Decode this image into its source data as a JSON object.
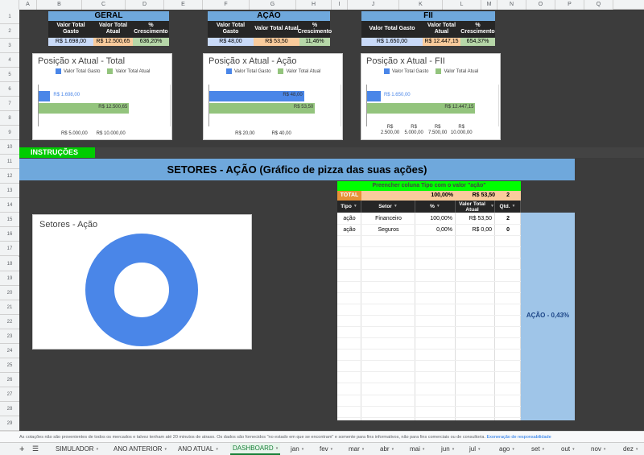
{
  "columns": [
    "A",
    "B",
    "C",
    "D",
    "E",
    "F",
    "G",
    "H",
    "I",
    "J",
    "K",
    "L",
    "M",
    "N",
    "O",
    "P",
    "Q",
    "R"
  ],
  "rows": [
    "1",
    "2",
    "3",
    "4",
    "5",
    "6",
    "7",
    "8",
    "9",
    "10",
    "11",
    "12",
    "13",
    "14",
    "15",
    "16",
    "17",
    "18",
    "19",
    "20",
    "21",
    "22",
    "23",
    "24",
    "25",
    "26",
    "27",
    "28",
    "29"
  ],
  "summary": {
    "geral": {
      "title": "GERAL",
      "h1": "Valor Total Gasto",
      "h2": "Valor Total Atual",
      "h3": "% Crescimento",
      "v1": "R$ 1.698,00",
      "v2": "R$ 12.500,65",
      "v3": "636,20%"
    },
    "acao": {
      "title": "AÇÃO",
      "h1": "Valor Total Gasto",
      "h2": "Valor Total Atual",
      "h3": "% Crescimento",
      "v1": "R$ 48,00",
      "v2": "R$ 53,50",
      "v3": "11,46%"
    },
    "fii": {
      "title": "FII",
      "h1": "Valor Total Gasto",
      "h2": "Valor Total Atual",
      "h3": "% Crescimento",
      "v1": "R$ 1.650,00",
      "v2": "R$ 12.447,15",
      "v3": "654,37%"
    }
  },
  "legend": {
    "gasto": "Valor Total Gasto",
    "atual": "Valor Total Atual"
  },
  "colors": {
    "gasto": "#4a86e8",
    "atual": "#93c47d",
    "header_blue": "#6fa8dc",
    "header_green": "#00ff00",
    "gray_band": "#b7b7b7"
  },
  "chart_data": [
    {
      "type": "bar",
      "title": "Posição x Atual - Total",
      "series": [
        {
          "name": "Valor Total Gasto",
          "values": [
            1698.0
          ]
        },
        {
          "name": "Valor Total Atual",
          "values": [
            12500.65
          ]
        }
      ],
      "labels": [
        "R$ 1.698,00",
        "R$ 12.500,65"
      ],
      "xticks": [
        "R$ 5.000,00",
        "R$ 10.000,00"
      ],
      "xlim": [
        0,
        15000
      ]
    },
    {
      "type": "bar",
      "title": "Posição x Atual - Ação",
      "series": [
        {
          "name": "Valor Total Gasto",
          "values": [
            48.0
          ]
        },
        {
          "name": "Valor Total Atual",
          "values": [
            53.5
          ]
        }
      ],
      "labels": [
        "R$ 48,00",
        "R$ 53,50"
      ],
      "xticks": [
        "R$ 20,00",
        "R$ 40,00"
      ],
      "xlim": [
        0,
        55
      ]
    },
    {
      "type": "bar",
      "title": "Posição x Atual - FII",
      "series": [
        {
          "name": "Valor Total Gasto",
          "values": [
            1650.0
          ]
        },
        {
          "name": "Valor Total Atual",
          "values": [
            12447.15
          ]
        }
      ],
      "labels": [
        "R$ 1.650,00",
        "R$ 12.447,15"
      ],
      "xticks": [
        "R$ 2.500,00",
        "R$ 5.000,00",
        "R$ 7.500,00",
        "R$ 10.000,00"
      ],
      "xlim": [
        0,
        12500
      ]
    },
    {
      "type": "pie",
      "title": "Setores - Ação",
      "labels": [
        "Financeiro",
        "Seguros"
      ],
      "values": [
        100.0,
        0.0
      ]
    }
  ],
  "instrucoes": "INSTRUÇÕES",
  "banner": "SETORES - AÇÃO  (Gráfico de pizza das suas ações)",
  "sector_table": {
    "instruction": "Preencher coluna Tipo com o valor \"ação\"",
    "total_label": "TOTAL",
    "total_pct": "100,00%",
    "total_val": "R$ 53,50",
    "total_qtd": "2",
    "headers": [
      "Tipo",
      "Setor",
      "%",
      "Valor Total Atual",
      "Qtd."
    ],
    "rows": [
      {
        "tipo": "ação",
        "setor": "Financeiro",
        "pct": "100,00%",
        "valor": "R$ 53,50",
        "qtd": "2"
      },
      {
        "tipo": "ação",
        "setor": "Seguros",
        "pct": "0,00%",
        "valor": "R$ 0,00",
        "qtd": "0"
      }
    ]
  },
  "side_label": "AÇÃO -  0,43%",
  "footer": {
    "disclaimer": "As cotações não são provenientes de todos os mercados e talvez tenham até 20 minutos de atraso. Os dados são fornecidos \"no estado em que se encontram\" e somente para fins informativos, não para fins comerciais ou de consultoria.",
    "link": "Exoneração de responsabilidade"
  },
  "tabs": [
    "SIMULADOR",
    "ANO ANTERIOR",
    "ANO ATUAL",
    "DASHBOARD",
    "jan",
    "fev",
    "mar",
    "abr",
    "mai",
    "jun",
    "jul",
    "ago",
    "set",
    "out",
    "nov",
    "dez"
  ],
  "active_tab": "DASHBOARD"
}
